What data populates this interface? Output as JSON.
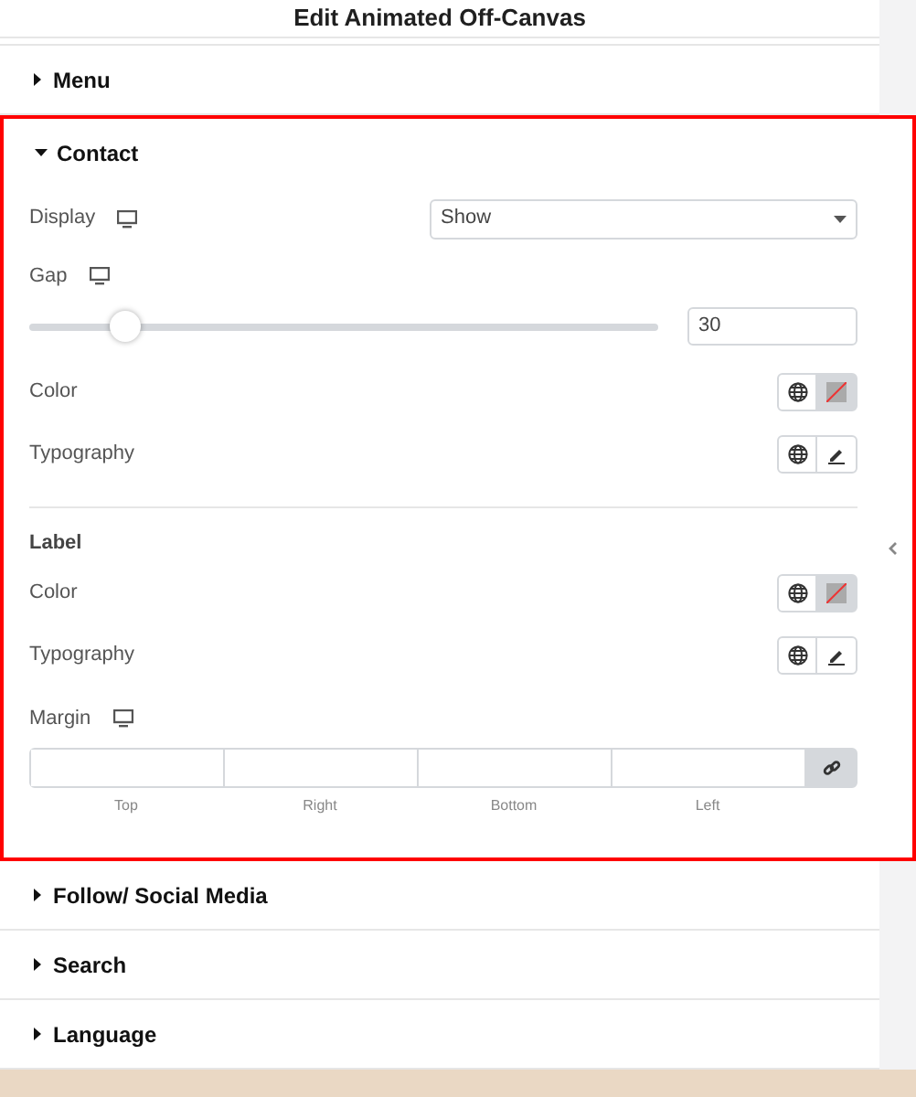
{
  "title": "Edit Animated Off-Canvas",
  "sections": [
    {
      "label": "Menu",
      "expanded": false,
      "highlighted": false
    },
    {
      "label": "Contact",
      "expanded": true,
      "highlighted": true,
      "controls": [
        {
          "kind": "select",
          "label": "Display",
          "responsive": true,
          "value": "Show"
        },
        {
          "kind": "slider",
          "label": "Gap",
          "responsive": true,
          "level": 0.15,
          "value": "30"
        },
        {
          "kind": "color",
          "label": "Color"
        },
        {
          "kind": "typography",
          "label": "Typography"
        },
        {
          "kind": "heading",
          "label": "Label"
        },
        {
          "kind": "color",
          "label": "Color"
        },
        {
          "kind": "typography",
          "label": "Typography"
        },
        {
          "kind": "dimensions",
          "label": "Margin",
          "responsive": true,
          "sides": [
            "Top",
            "Right",
            "Bottom",
            "Left"
          ]
        }
      ]
    },
    {
      "label": "Follow/ Social Media",
      "expanded": false,
      "highlighted": false
    },
    {
      "label": "Search",
      "expanded": false,
      "highlighted": false
    },
    {
      "label": "Language",
      "expanded": false,
      "highlighted": false
    }
  ]
}
